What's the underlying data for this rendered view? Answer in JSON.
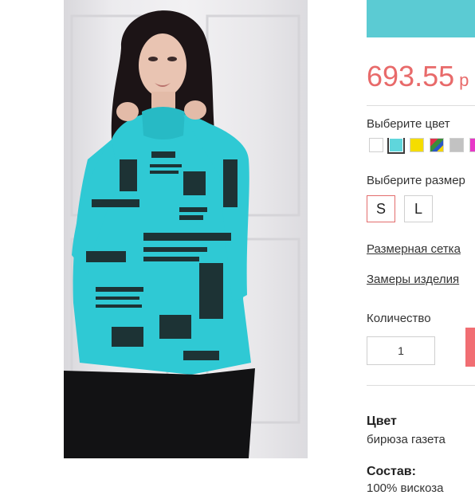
{
  "product": {
    "price_value": "693.55",
    "price_currency": "р"
  },
  "color_picker": {
    "label": "Выберите цвет",
    "swatches": [
      {
        "name": "white",
        "color": "#ffffff"
      },
      {
        "name": "turquoise",
        "color": "#5fd6dc"
      },
      {
        "name": "yellow",
        "color": "#f5dd00"
      },
      {
        "name": "multicolor",
        "color": "#3a8d3a"
      },
      {
        "name": "grey",
        "color": "#c2c2c2"
      },
      {
        "name": "pink",
        "color": "#e838c8"
      }
    ],
    "selected_index": 1
  },
  "size_picker": {
    "label": "Выберите размер",
    "sizes": [
      "S",
      "L"
    ],
    "selected": "S"
  },
  "links": {
    "size_chart": "Размерная сетка",
    "measurements": "Замеры изделия"
  },
  "quantity": {
    "label": "Количество",
    "value": "1"
  },
  "specs": {
    "color_title": "Цвет",
    "color_value": "бирюза газета",
    "composition_title": "Состав:",
    "composition_value": "100% вискоза"
  },
  "colors": {
    "accent_teal": "#5bcbd3",
    "price_red": "#e86a6a",
    "cart_red": "#f16e73"
  }
}
